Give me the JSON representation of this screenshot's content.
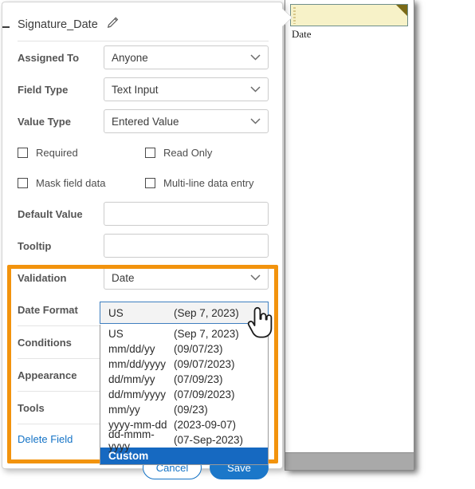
{
  "document_preview": {
    "field_label": "Date",
    "field_value": "",
    "field_bg_color": "#f7f2c8",
    "field_corner_color": "#7a6a17"
  },
  "properties_panel": {
    "title": "Signature_Date",
    "edit_icon": "pencil-icon",
    "rows": [
      {
        "label": "Assigned To",
        "value": "Anyone",
        "control": "select"
      },
      {
        "label": "Field Type",
        "value": "Text Input",
        "control": "select"
      },
      {
        "label": "Value Type",
        "value": "Entered Value",
        "control": "select"
      }
    ],
    "checkboxes": [
      {
        "label": "Required",
        "checked": false
      },
      {
        "label": "Read Only",
        "checked": false
      },
      {
        "label": "Mask field data",
        "checked": false
      },
      {
        "label": "Multi-line data entry",
        "checked": false
      }
    ],
    "text_fields": [
      {
        "label": "Default Value",
        "value": "",
        "placeholder": ""
      },
      {
        "label": "Tooltip",
        "value": "",
        "placeholder": ""
      }
    ],
    "validation": {
      "label": "Validation",
      "value": "Date"
    },
    "date_format": {
      "label": "Date Format",
      "value": "US",
      "example": "(Sep 7, 2023)"
    },
    "sections": [
      {
        "label": "Conditions"
      },
      {
        "label": "Appearance"
      },
      {
        "label": "Tools"
      }
    ],
    "delete_link": "Delete Field",
    "buttons": [
      {
        "label": "Cancel",
        "style": "secondary"
      },
      {
        "label": "Save",
        "style": "primary"
      }
    ]
  },
  "date_format_dropdown": {
    "open": true,
    "selected": "Custom",
    "options": [
      {
        "name": "US",
        "example": "(Sep 7, 2023)"
      },
      {
        "name": "mm/dd/yy",
        "example": "(09/07/23)"
      },
      {
        "name": "mm/dd/yyyy",
        "example": "(09/07/2023)"
      },
      {
        "name": "dd/mm/yy",
        "example": "(07/09/23)"
      },
      {
        "name": "dd/mm/yyyy",
        "example": "(07/09/2023)"
      },
      {
        "name": "mm/yy",
        "example": "(09/23)"
      },
      {
        "name": "yyyy-mm-dd",
        "example": "(2023-09-07)"
      },
      {
        "name": "dd-mmm-yyyy",
        "example": "(07-Sep-2023)"
      },
      {
        "name": "Custom",
        "example": ""
      }
    ]
  },
  "annotation": {
    "highlight_color": "#f2930d",
    "highlight_shape": "rectangle"
  },
  "cursor": {
    "type": "pointing-hand-cursor"
  },
  "colors": {
    "link": "#1473c6",
    "primary_button": "#1b77c9",
    "selected_row": "#1669c1",
    "orange_highlight": "#f2930d"
  }
}
